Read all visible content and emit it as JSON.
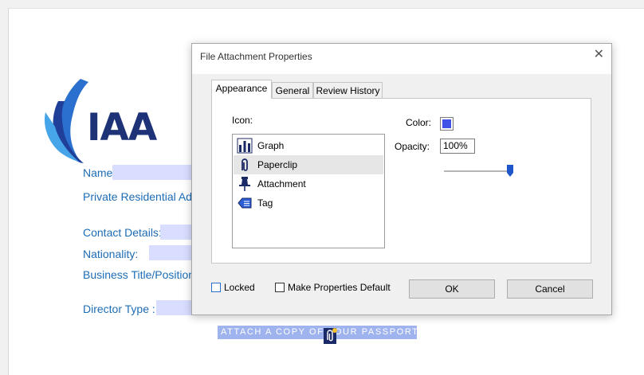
{
  "document": {
    "logo_text": "IAA",
    "labels": {
      "name": "Name:",
      "address": "Private Residential Addı",
      "contact": "Contact Details:",
      "nationality": "Nationality:",
      "business": "Business Title/Position:",
      "director": "Director Type :"
    },
    "passport_text": "ATTACH A COPY OF YOUR PASSPORT",
    "colors": {
      "label": "#1d6cb5",
      "field": "#d9ddff",
      "passport_bar": "#9fb3ee"
    }
  },
  "dialog": {
    "title": "File Attachment Properties",
    "close_icon": "close-icon",
    "tabs": [
      "Appearance",
      "General",
      "Review History"
    ],
    "active_tab": "Appearance",
    "icon_label": "Icon:",
    "icons": [
      {
        "label": "Graph",
        "icon": "graph-icon"
      },
      {
        "label": "Paperclip",
        "icon": "paperclip-icon"
      },
      {
        "label": "Attachment",
        "icon": "pushpin-icon"
      },
      {
        "label": "Tag",
        "icon": "tag-icon"
      }
    ],
    "selected_icon": "Paperclip",
    "color_label": "Color:",
    "color_value": "#3f51e6",
    "opacity_label": "Opacity:",
    "opacity_value": "100%",
    "opacity_slider_level": 1.0,
    "locked_label": "Locked",
    "locked_checked": false,
    "make_default_label": "Make Properties Default",
    "make_default_checked": false,
    "ok_label": "OK",
    "cancel_label": "Cancel"
  }
}
